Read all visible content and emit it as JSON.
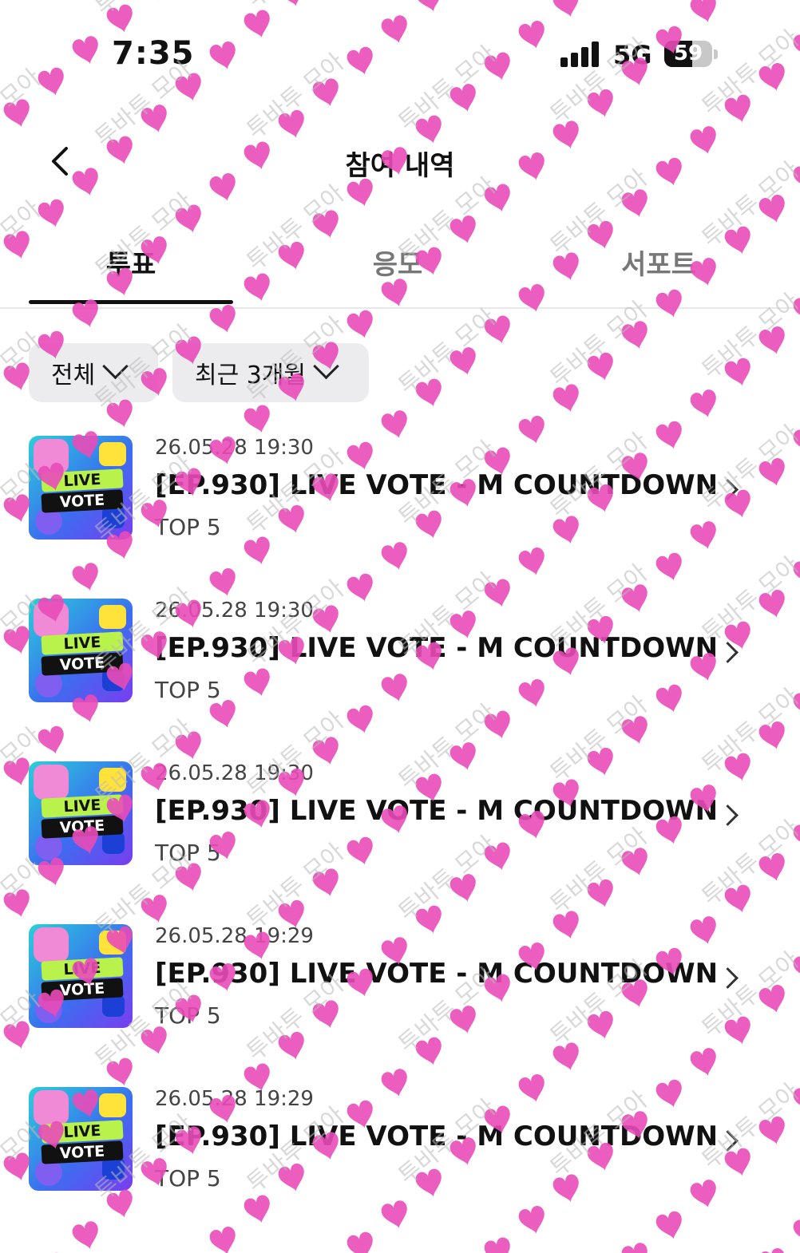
{
  "status_bar": {
    "time": "7:35",
    "network": "5G",
    "battery": "59",
    "battery_level_percent": 59
  },
  "header": {
    "title": "참여 내역",
    "back_icon": "chevron-left-icon"
  },
  "tabs": [
    {
      "label": "투표",
      "active": true
    },
    {
      "label": "응모",
      "active": false
    },
    {
      "label": "서포트",
      "active": false
    }
  ],
  "filters": [
    {
      "label": "전체"
    },
    {
      "label": "최근 3개월"
    }
  ],
  "items": [
    {
      "thumb_line1": "LIVE",
      "thumb_line2": "VOTE",
      "date": "26.05.28 19:30",
      "title": "[EP.930] LIVE VOTE - M COUNTDOWN",
      "rank": "TOP 5"
    },
    {
      "thumb_line1": "LIVE",
      "thumb_line2": "VOTE",
      "date": "26.05.28 19:30",
      "title": "[EP.930] LIVE VOTE - M COUNTDOWN",
      "rank": "TOP 5"
    },
    {
      "thumb_line1": "LIVE",
      "thumb_line2": "VOTE",
      "date": "26.05.28 19:30",
      "title": "[EP.930] LIVE VOTE - M COUNTDOWN",
      "rank": "TOP 5"
    },
    {
      "thumb_line1": "LIVE",
      "thumb_line2": "VOTE",
      "date": "26.05.28 19:29",
      "title": "[EP.930] LIVE VOTE - M COUNTDOWN",
      "rank": "TOP 5"
    },
    {
      "thumb_line1": "LIVE",
      "thumb_line2": "VOTE",
      "date": "26.05.28 19:29",
      "title": "[EP.930] LIVE VOTE - M COUNTDOWN",
      "rank": "TOP 5"
    }
  ],
  "watermark": {
    "text": "투바투 모아",
    "heart_color": "#e94bb8"
  }
}
